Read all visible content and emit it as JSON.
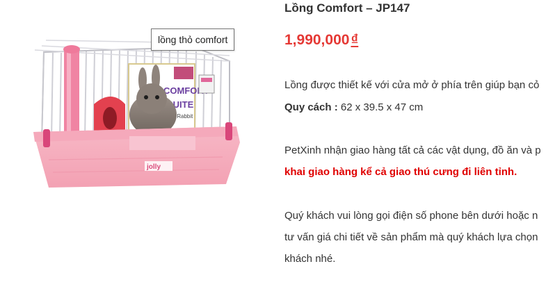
{
  "tooltip": "lồng thỏ comfort",
  "product": {
    "title": "Lồng Comfort – JP147",
    "price": "1,990,000",
    "currency": "₫",
    "image_brand": "jolly",
    "image_box_text": [
      "COMFORT",
      "SUITE",
      "For Rabbit"
    ]
  },
  "description": {
    "line1": " Lồng được thiết kế với cửa mở ở phía trên giúp bạn cỏ",
    "spec_label": "Quy cách :",
    "spec_value": " 62 x 39.5 x 47 cm",
    "line3": "PetXinh nhận giao hàng tất cả các vật dụng, đồ ăn và p",
    "line4": "khai giao hàng kể cả giao thú cưng đi liên tỉnh.",
    "line5": "Quý khách vui lòng gọi điện số phone bên dưới hoặc n",
    "line6": "tư vấn giá chi tiết về sản phẩm mà quý khách lựa chọn",
    "line7": "khách nhé."
  }
}
